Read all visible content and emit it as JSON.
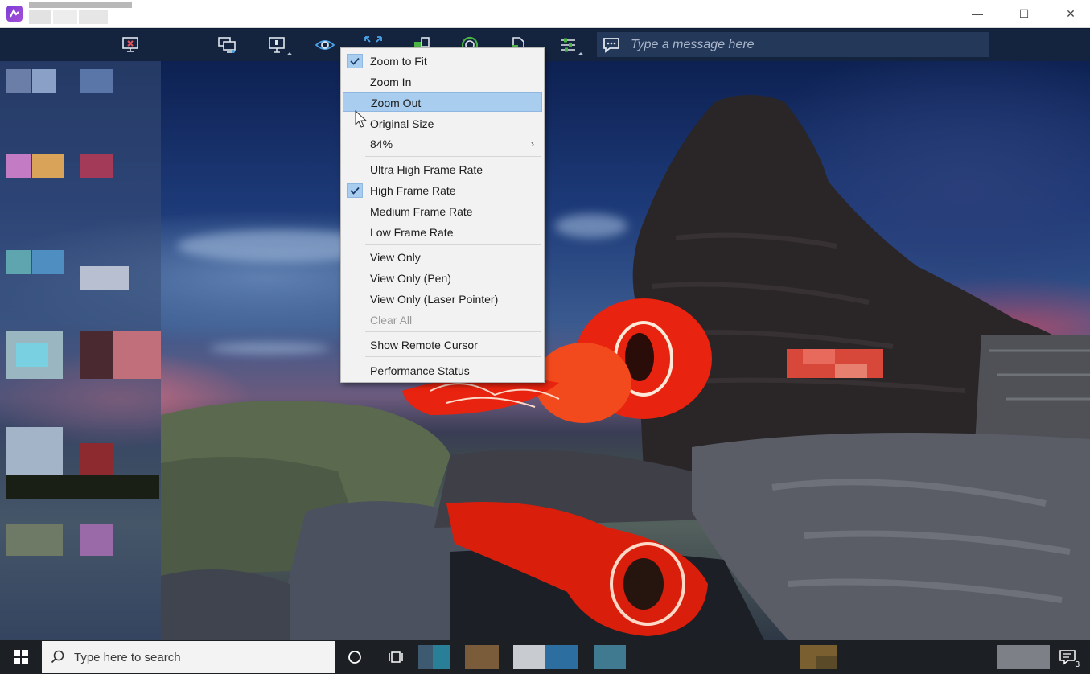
{
  "window": {
    "controls": {
      "minimize": "—",
      "maximize": "☐",
      "close": "✕"
    }
  },
  "toolbar": {
    "message_placeholder": "Type a message here",
    "icons": [
      "end-session-icon",
      "switch-monitor-icon",
      "display-icon",
      "view-icon",
      "zoom-icon",
      "file-transfer-icon",
      "record-icon",
      "clipboard-icon",
      "settings-icon",
      "chat-icon"
    ]
  },
  "menu": {
    "items": [
      {
        "label": "Zoom to Fit",
        "checked": true
      },
      {
        "label": "Zoom In"
      },
      {
        "label": "Zoom Out",
        "hovered": true
      },
      {
        "label": "Original Size"
      },
      {
        "label": "84%",
        "submenu_arrow": "›"
      },
      {
        "label": "Ultra High Frame Rate"
      },
      {
        "label": "High Frame Rate",
        "checked": true
      },
      {
        "label": "Medium Frame Rate"
      },
      {
        "label": "Low Frame Rate"
      },
      {
        "label": "View Only"
      },
      {
        "label": "View Only (Pen)"
      },
      {
        "label": "View Only (Laser Pointer)"
      },
      {
        "label": "Clear All",
        "disabled": true
      },
      {
        "label": "Show Remote Cursor"
      },
      {
        "label": "Performance Status"
      }
    ]
  },
  "taskbar": {
    "search_placeholder": "Type here to search",
    "notification_count": "3"
  },
  "colors": {
    "toolbar_bg": "#14243f",
    "menu_highlight": "#a9cdee",
    "taskbar_bg": "#1c1f24",
    "app_icon": "#7b3fd6"
  }
}
